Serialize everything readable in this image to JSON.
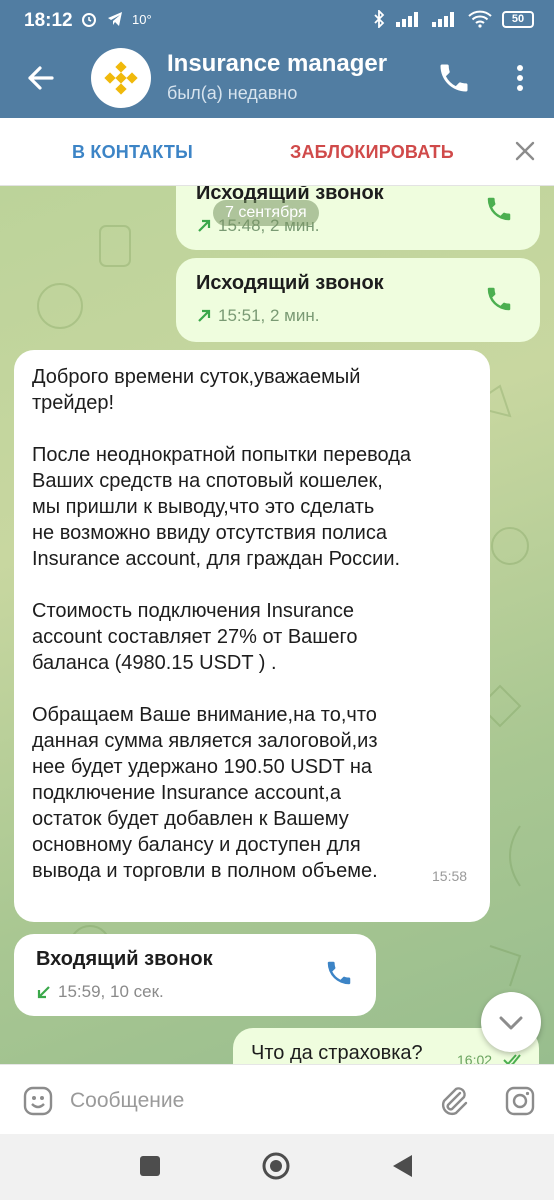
{
  "status_bar": {
    "time": "18:12",
    "temperature": "10°",
    "battery": "50"
  },
  "header": {
    "title": "Insurance manager",
    "subtitle": "был(а) недавно",
    "avatar_icon": "binance-logo-icon"
  },
  "actions": {
    "add_contact": "В КОНТАКТЫ",
    "block": "ЗАБЛОКИРОВАТЬ"
  },
  "chat": {
    "date_label": "7 сентября",
    "messages": [
      {
        "type": "call",
        "direction": "outgoing",
        "title": "Исходящий звонок",
        "meta": "15:48, 2 мин."
      },
      {
        "type": "call",
        "direction": "outgoing",
        "title": "Исходящий звонок",
        "meta": "15:51, 2 мин."
      },
      {
        "type": "text",
        "direction": "incoming",
        "text": "Доброго времени суток,уважаемый\nтрейдер!\n\nПосле неоднократной попытки перевода\nВаших средств на спотовый кошелек,\nмы пришли к выводу,что это сделать\nне возможно ввиду отсутствия полиса\nInsurance account, для граждан России.\n\nСтоимость подключения  Insurance\naccount составляет 27% от Вашего\nбаланса (4980.15 USDT ) .\n\nОбращаем Ваше внимание,на то,что\nданная сумма является залоговой,из\nнее будет удержано 190.50 USDT на\nподключение  Insurance account,а\nостаток будет добавлен к Вашему\nосновному балансу и доступен для\nвывода и торговли в полном объеме.",
        "time": "15:58"
      },
      {
        "type": "call",
        "direction": "incoming",
        "title": "Входящий звонок",
        "meta": "15:59, 10 сек."
      },
      {
        "type": "text",
        "direction": "outgoing",
        "text": "Что да страховка?",
        "time": "16:02"
      }
    ]
  },
  "composer": {
    "placeholder": "Сообщение"
  },
  "colors": {
    "header_bg": "#517da2",
    "accent_blue": "#3c84c6",
    "block_red": "#d04a4a",
    "outgoing_bubble": "#effdde",
    "call_green": "#4caf50"
  }
}
